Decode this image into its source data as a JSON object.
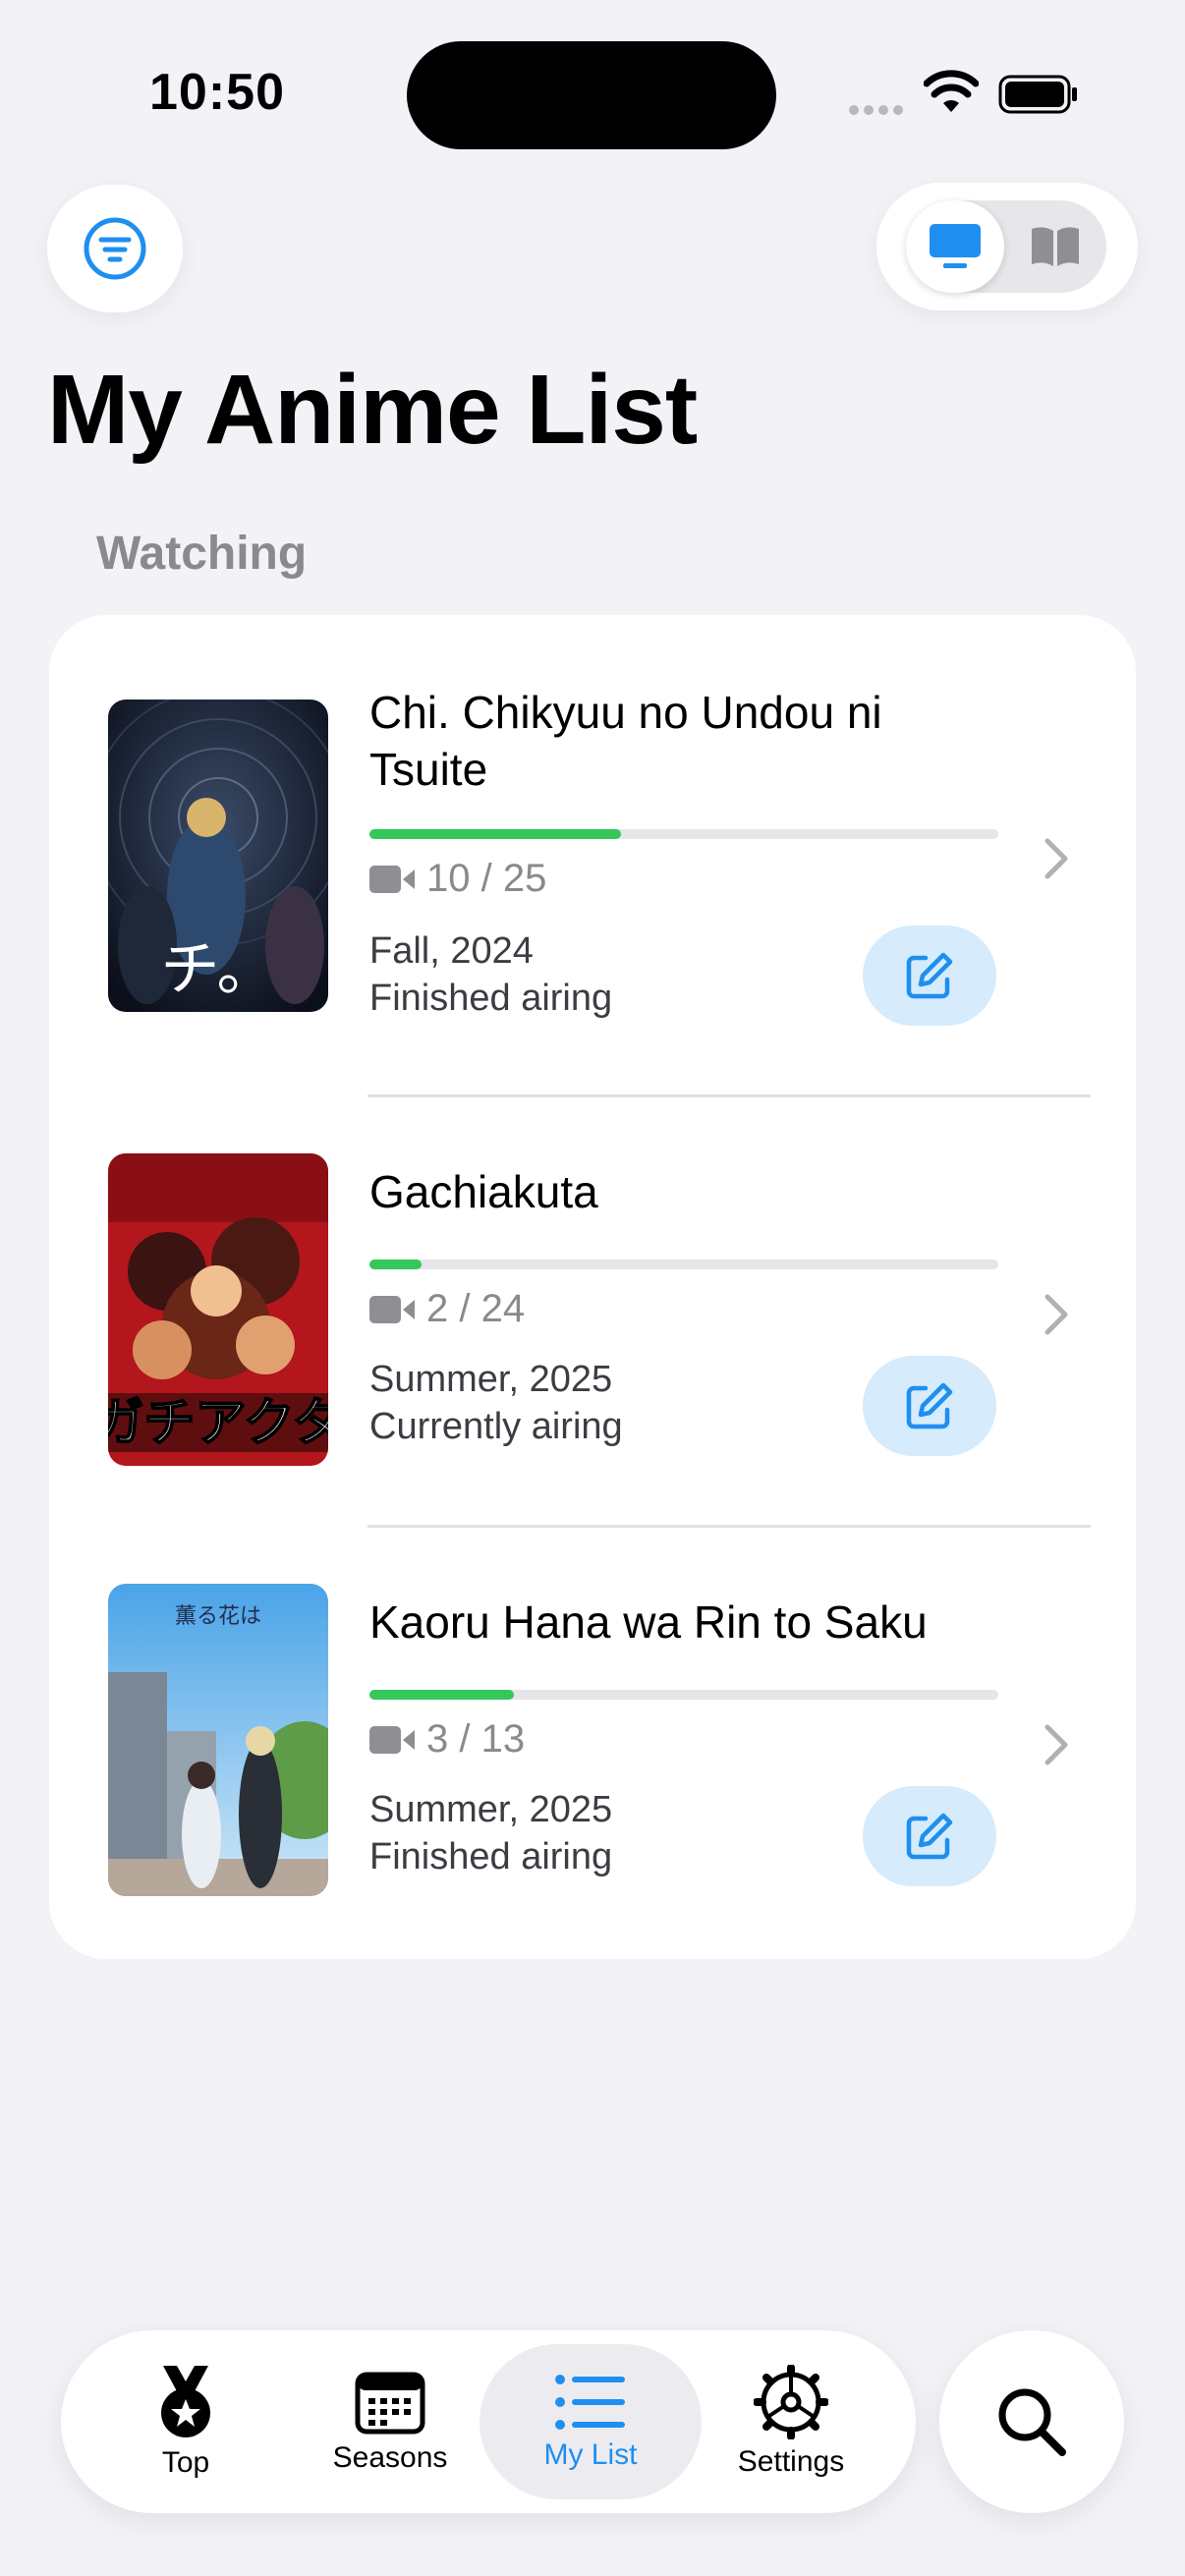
{
  "status_bar": {
    "time": "10:50"
  },
  "header": {
    "title": "My Anime List"
  },
  "media_toggle": {
    "selected": "anime",
    "options": [
      "tv-icon",
      "book-icon"
    ]
  },
  "section": {
    "label": "Watching"
  },
  "items": [
    {
      "title": "Chi. Chikyuu no Undou ni Tsuite",
      "episodes": "10 / 25",
      "progress": 0.4,
      "season": "Fall, 2024",
      "status": "Finished airing"
    },
    {
      "title": "Gachiakuta",
      "episodes": "2 / 24",
      "progress": 0.083,
      "season": "Summer, 2025",
      "status": "Currently airing"
    },
    {
      "title": "Kaoru Hana wa Rin to Saku",
      "episodes": "3 / 13",
      "progress": 0.23,
      "season": "Summer, 2025",
      "status": "Finished airing"
    }
  ],
  "tabs": [
    {
      "label": "Top",
      "icon": "medal-icon"
    },
    {
      "label": "Seasons",
      "icon": "calendar-icon"
    },
    {
      "label": "My List",
      "icon": "list-icon",
      "active": true
    },
    {
      "label": "Settings",
      "icon": "gear-icon"
    }
  ],
  "colors": {
    "accent": "#1e8ff0",
    "progress": "#34c759",
    "edit_bg": "#d6ebfb"
  }
}
